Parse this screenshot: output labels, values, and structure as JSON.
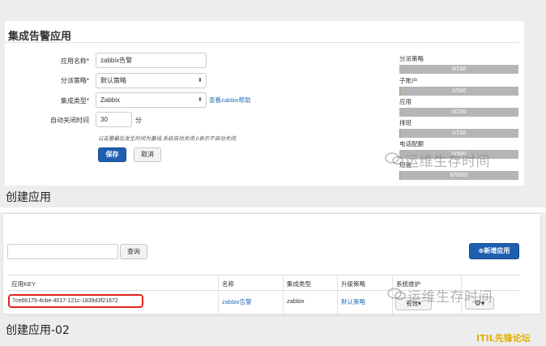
{
  "panel1": {
    "title": "集成告警应用",
    "form": {
      "app_name_label": "应用名称*",
      "app_name_value": "zabbix告警",
      "dispatch_label": "分派策略*",
      "dispatch_value": "默认策略",
      "integration_label": "集成类型*",
      "integration_value": "Zabbix",
      "help_link": "查看zabbix帮助",
      "auto_close_label": "自动关闭时间",
      "auto_close_value": "30",
      "auto_close_unit": "分",
      "hint": "以告警最后发生时间为基线,系统自动关闭,0表示不自动关闭.",
      "save_label": "保存",
      "cancel_label": "取消"
    },
    "stats": [
      {
        "label": "分派策略",
        "value": "0/150",
        "fraction": 0.0
      },
      {
        "label": "子账户",
        "value": "1/500",
        "fraction": 0.002
      },
      {
        "label": "应用",
        "value": "0/150",
        "fraction": 0.0
      },
      {
        "label": "排班",
        "value": "1/150",
        "fraction": 0.007
      },
      {
        "label": "电话配额",
        "value": "0/500",
        "fraction": 0.0
      },
      {
        "label": "短信",
        "value": "6/5000",
        "fraction": 0.001
      }
    ],
    "caption": "创建应用"
  },
  "panel2": {
    "search_label": "查询",
    "add_label": "新增应用",
    "columns": [
      "应用KEY",
      "名称",
      "集成类型",
      "升级策略",
      "系统维护"
    ],
    "row": {
      "key": "7ce66175-4cbe-4017-121c-1839d3f21672",
      "name": "zabbix告警",
      "type": "zabbix",
      "policy": "默认策略",
      "status": "有效"
    },
    "caption": "创建应用-02"
  },
  "watermark": "运维生存时间",
  "footer_brand": "ITIL先锋论坛",
  "colors": {
    "primary": "#1f5fb0",
    "link": "#2a6fb7",
    "highlight": "#e0261e",
    "brand": "#e0b000"
  }
}
